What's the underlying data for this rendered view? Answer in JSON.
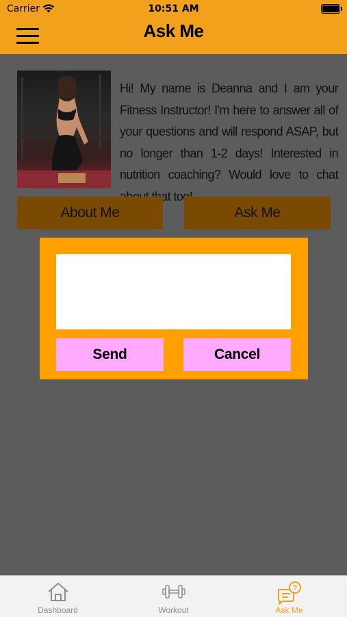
{
  "status_bar": {
    "carrier": "Carrier",
    "time": "10:51 AM"
  },
  "header": {
    "title": "Ask Me",
    "menu_icon": "hamburger-menu-icon"
  },
  "profile": {
    "photo_icon": "instructor-photo",
    "bio": "Hi! My name is Deanna and I am your Fitness Instructor! I'm here to answer all of your questions and will respond ASAP, but no longer than 1-2 days! Interested in nutrition coaching? Would love to chat about that too!"
  },
  "segment": {
    "about_label": "About Me",
    "ask_label": "Ask Me"
  },
  "dialog": {
    "message_value": "",
    "send_label": "Send",
    "cancel_label": "Cancel"
  },
  "tabbar": {
    "items": [
      {
        "label": "Dashboard",
        "icon": "house-icon",
        "active": false
      },
      {
        "label": "Workout",
        "icon": "dumbbell-icon",
        "active": false
      },
      {
        "label": "Ask Me",
        "icon": "chat-question-icon",
        "active": true
      }
    ]
  },
  "colors": {
    "header": "#f2a11c",
    "background": "#5c5c5c",
    "segment_button": "#7a4a03",
    "dialog": "#ff9f00",
    "dialog_button": "#ffaaff",
    "active_tab": "#f2a11c"
  }
}
